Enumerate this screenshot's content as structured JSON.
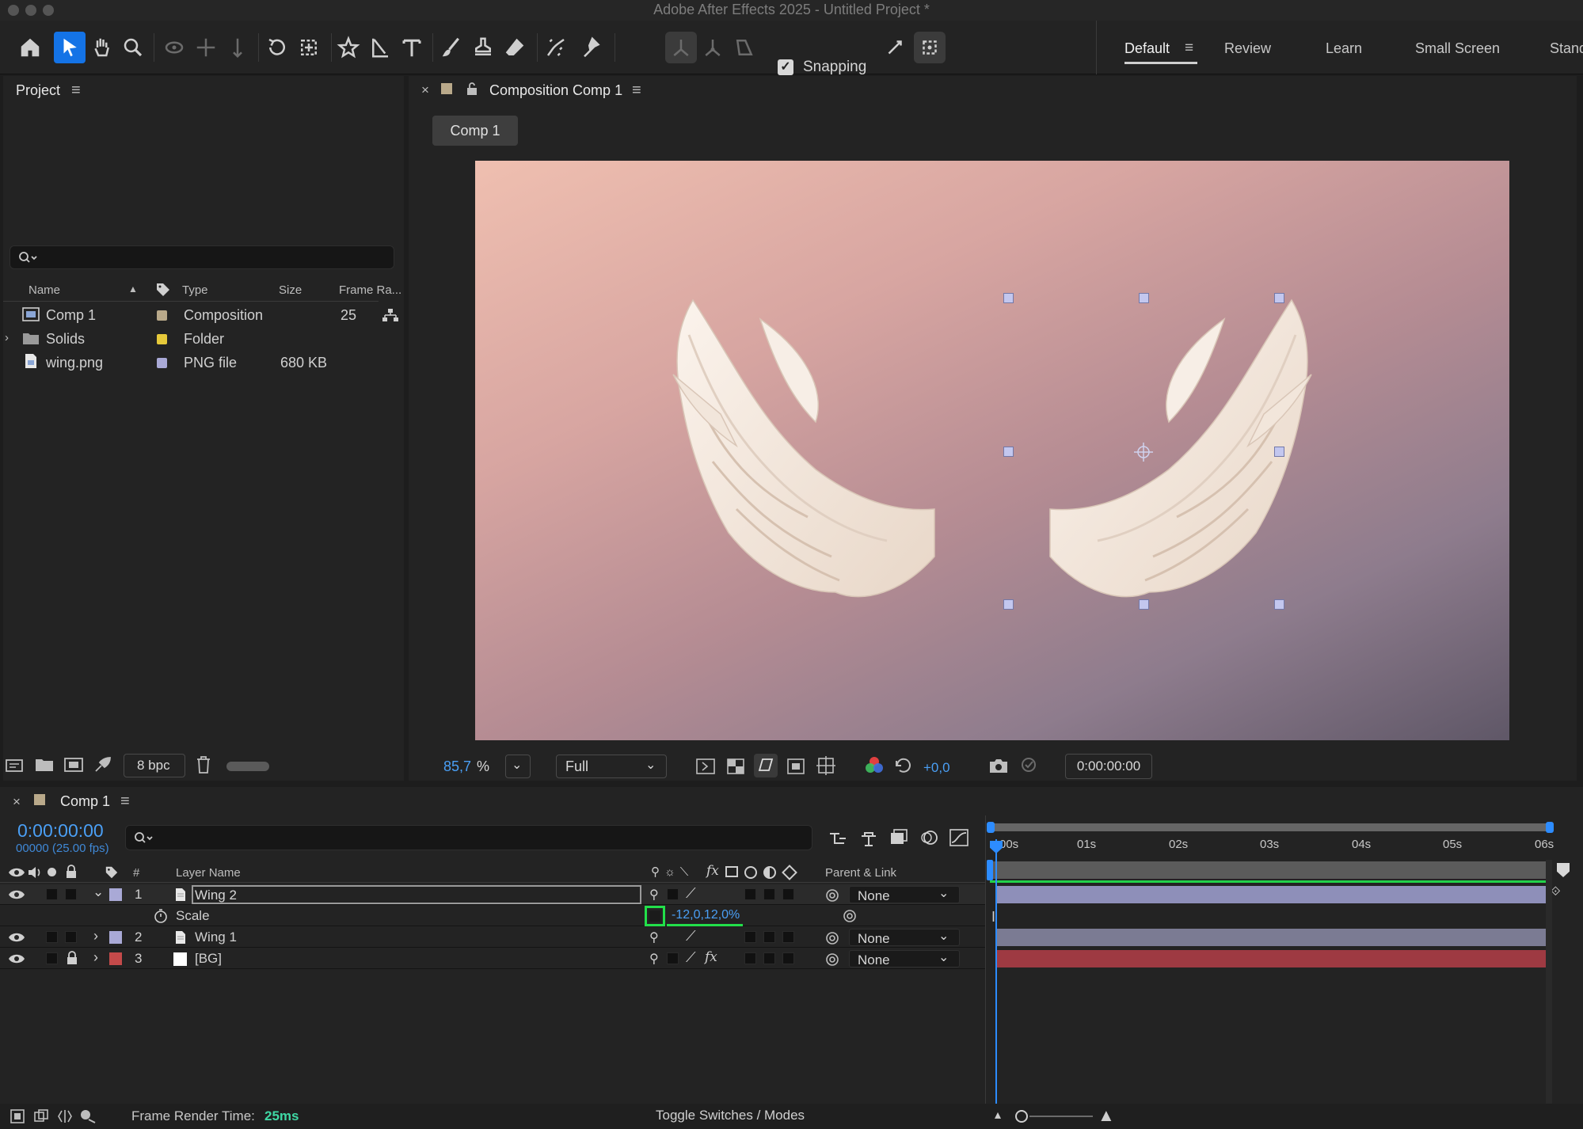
{
  "window": {
    "title": "Adobe After Effects 2025 - Untitled Project *"
  },
  "toolbar": {
    "snapping_label": "Snapping",
    "workspaces": [
      "Default",
      "Review",
      "Learn",
      "Small Screen",
      "Stand"
    ]
  },
  "project": {
    "title": "Project",
    "columns": [
      "Name",
      "Type",
      "Size",
      "Frame Ra..."
    ],
    "items": [
      {
        "name": "Comp 1",
        "type": "Composition",
        "size": "",
        "frame_rate": "25",
        "swatch": "#b9a98a"
      },
      {
        "name": "Solids",
        "type": "Folder",
        "size": "",
        "frame_rate": "",
        "swatch": "#e6c93a"
      },
      {
        "name": "wing.png",
        "type": "PNG file",
        "size": "680 KB",
        "frame_rate": "",
        "swatch": "#a9a9d6"
      }
    ],
    "bit_depth": "8 bpc"
  },
  "viewer": {
    "panel_title": "Composition Comp 1",
    "comp_tab": "Comp 1",
    "zoom": "85,7",
    "zoom_unit": "%",
    "quality": "Full",
    "exposure": "+0,0",
    "timecode": "0:00:00:00"
  },
  "timeline": {
    "tab": "Comp 1",
    "current_time": "0:00:00:00",
    "frame_info": "00000 (25.00 fps)",
    "col_hash": "#",
    "col_layer_name": "Layer Name",
    "col_parent": "Parent & Link",
    "layers": [
      {
        "num": "1",
        "name": "Wing 2",
        "parent": "None",
        "color": "#a9a9d6"
      },
      {
        "num": "2",
        "name": "Wing 1",
        "parent": "None",
        "color": "#a9a9d6"
      },
      {
        "num": "3",
        "name": "[BG]",
        "parent": "None",
        "color": "#c44a4a"
      }
    ],
    "property": {
      "name": "Scale",
      "value": "-12,0,12,0%"
    },
    "ruler_labels": [
      "00s",
      "01s",
      "02s",
      "03s",
      "04s",
      "05s",
      "06s"
    ],
    "render_time_label": "Frame Render Time:",
    "render_time_value": "25ms",
    "toggle_label": "Toggle Switches / Modes"
  }
}
